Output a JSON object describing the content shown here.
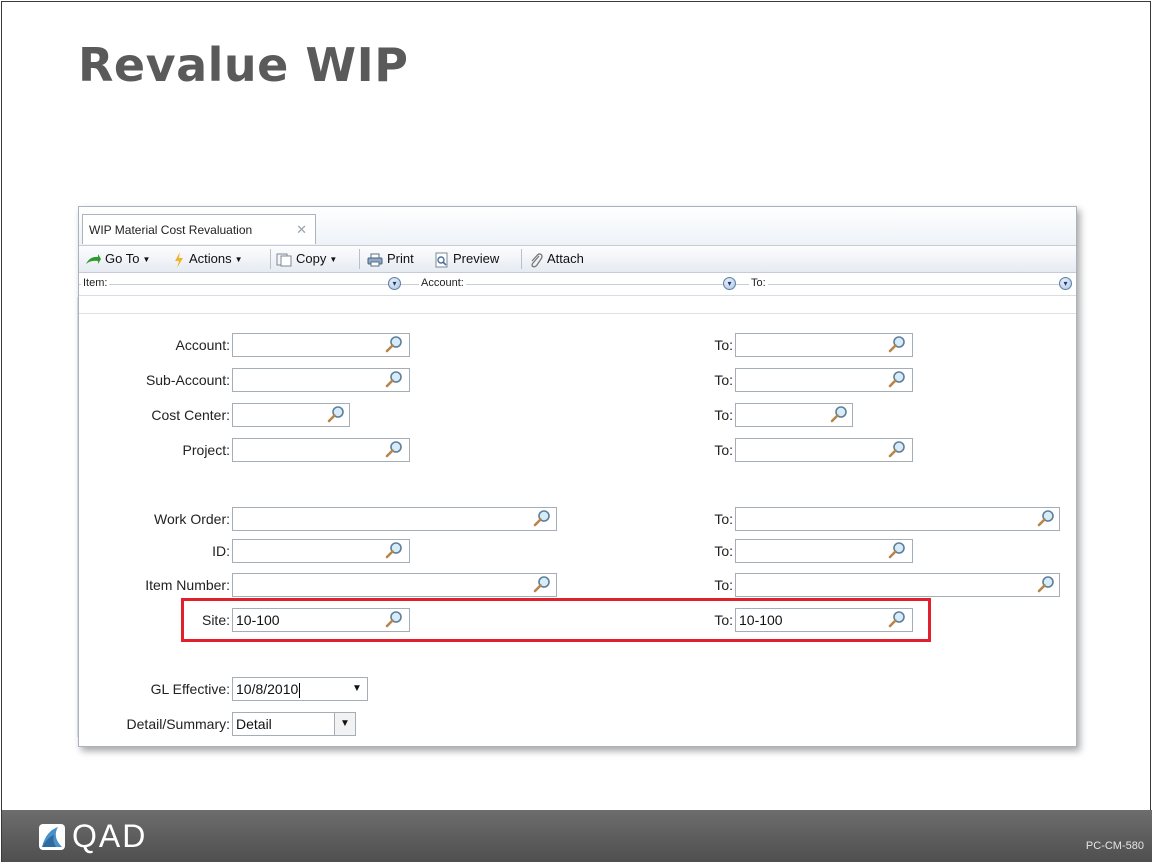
{
  "slide": {
    "title": "Revalue WIP",
    "footer_brand": "QAD",
    "footer_code": "PC-CM-580"
  },
  "window": {
    "tab_label": "WIP Material Cost Revaluation",
    "tab_close": "✕",
    "toolbar": {
      "goto": "Go To",
      "actions": "Actions",
      "copy": "Copy",
      "print": "Print",
      "preview": "Preview",
      "attach": "Attach"
    },
    "filterbar": {
      "item": "Item:",
      "account": "Account:",
      "to": "To:"
    }
  },
  "form": {
    "account": {
      "label": "Account:",
      "value": "",
      "to_label": "To:",
      "to_value": ""
    },
    "sub_account": {
      "label": "Sub-Account:",
      "value": "",
      "to_label": "To:",
      "to_value": ""
    },
    "cost_center": {
      "label": "Cost Center:",
      "value": "",
      "to_label": "To:",
      "to_value": ""
    },
    "project": {
      "label": "Project:",
      "value": "",
      "to_label": "To:",
      "to_value": ""
    },
    "work_order": {
      "label": "Work Order:",
      "value": "",
      "to_label": "To:",
      "to_value": ""
    },
    "id": {
      "label": "ID:",
      "value": "",
      "to_label": "To:",
      "to_value": ""
    },
    "item_number": {
      "label": "Item Number:",
      "value": "",
      "to_label": "To:",
      "to_value": ""
    },
    "site": {
      "label": "Site:",
      "value": "10-100",
      "to_label": "To:",
      "to_value": "10-100"
    },
    "gl_effective": {
      "label": "GL Effective:",
      "value": "10/8/2010"
    },
    "detail_summary": {
      "label": "Detail/Summary:",
      "value": "Detail"
    }
  },
  "colors": {
    "highlight": "#e0202a",
    "footer": "#5a5a5a"
  }
}
